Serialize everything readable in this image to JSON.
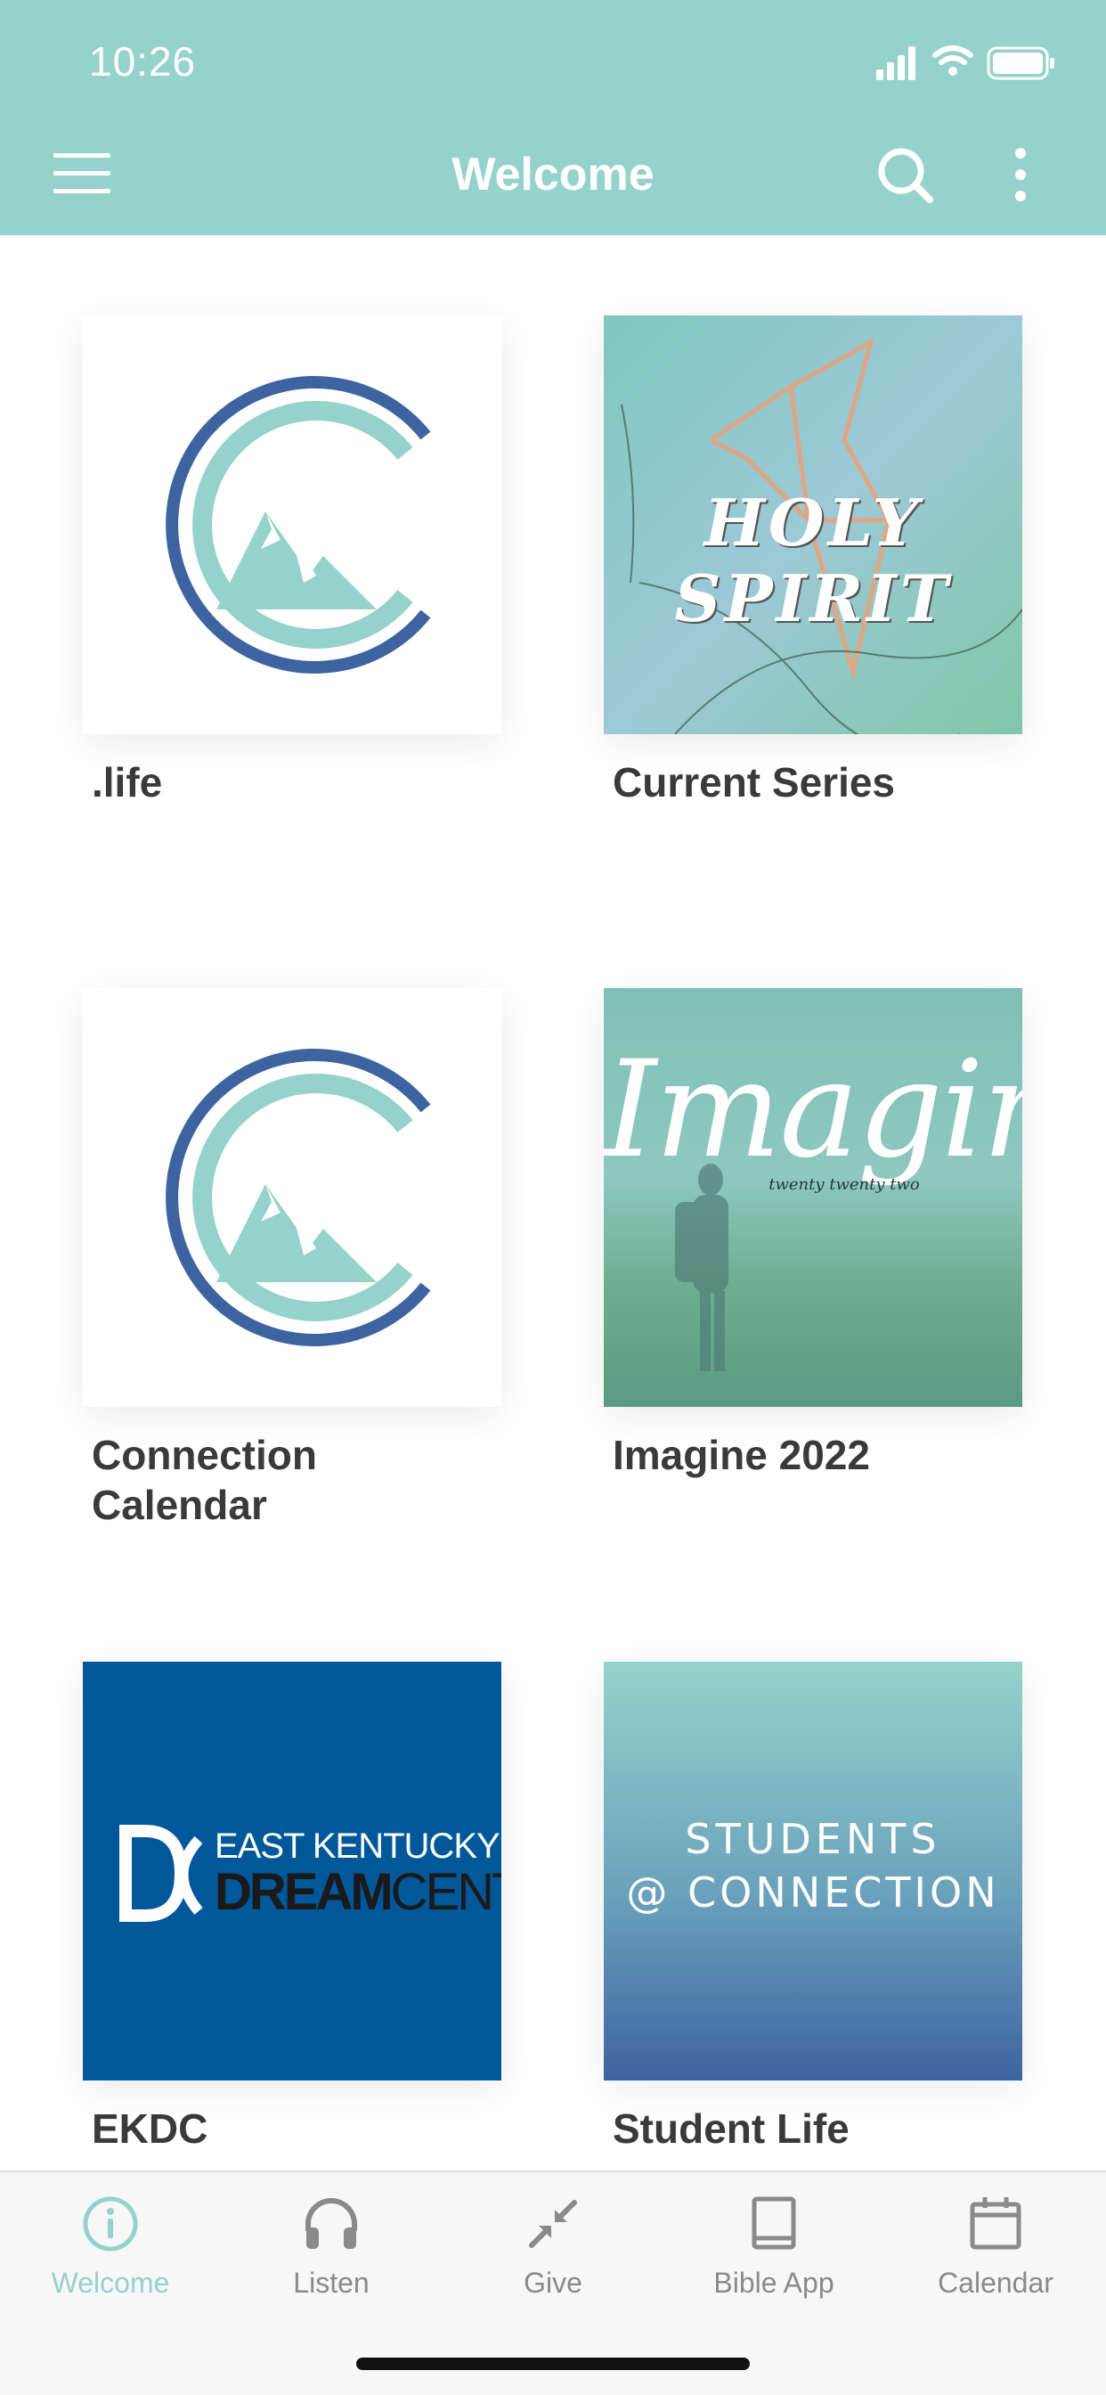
{
  "status_bar": {
    "time": "10:26"
  },
  "header": {
    "title": "Welcome"
  },
  "colors": {
    "accent": "#95d2cb",
    "logo_blue": "#3d64a0",
    "logo_teal": "#95d2cb",
    "ekdc_blue": "#00589b"
  },
  "tiles": [
    {
      "label": ".life",
      "icon": "connection-logo"
    },
    {
      "label": "Current Series",
      "image_text": "HOLY SPIRIT"
    },
    {
      "label": "Connection Calendar",
      "icon": "connection-logo"
    },
    {
      "label": "Imagine 2022",
      "image_text": "Imagine",
      "image_subtext": "twenty twenty two"
    },
    {
      "label": "EKDC",
      "image_text_top": "EAST KENTUCKY",
      "image_text_bold": "DREAM",
      "image_text_rest": "CENTER"
    },
    {
      "label": "Student Life",
      "image_text_line1": "STUDENTS",
      "image_text_line2": "@ CONNECTION"
    }
  ],
  "tabbar": {
    "items": [
      {
        "label": "Welcome",
        "icon": "info-icon",
        "active": true
      },
      {
        "label": "Listen",
        "icon": "headphones-icon",
        "active": false
      },
      {
        "label": "Give",
        "icon": "give-arrows-icon",
        "active": false
      },
      {
        "label": "Bible App",
        "icon": "book-icon",
        "active": false
      },
      {
        "label": "Calendar",
        "icon": "calendar-icon",
        "active": false
      }
    ]
  }
}
